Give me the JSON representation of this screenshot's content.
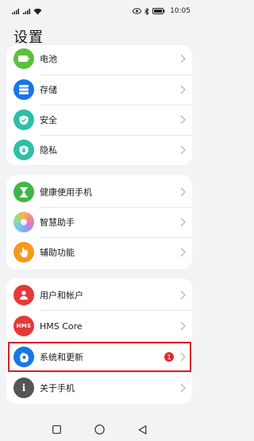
{
  "status_bar": {
    "left_small_1": "5G",
    "left_small_2": "5G",
    "battery": "100",
    "time": "10:05"
  },
  "page_title": "设置",
  "groups": [
    {
      "items": [
        {
          "label": "电池",
          "icon": "battery-icon",
          "color": "#5bbf3d"
        },
        {
          "label": "存储",
          "icon": "storage-icon",
          "color": "#1677e8"
        },
        {
          "label": "安全",
          "icon": "shield-icon",
          "color": "#2ebfa7"
        },
        {
          "label": "隐私",
          "icon": "privacy-icon",
          "color": "#2ebfa7"
        }
      ]
    },
    {
      "items": [
        {
          "label": "健康使用手机",
          "icon": "hourglass-icon",
          "color": "#3fb649"
        },
        {
          "label": "智慧助手",
          "icon": "assistant-icon",
          "color": "#c78af0"
        },
        {
          "label": "辅助功能",
          "icon": "hand-icon",
          "color": "#f59a1b"
        }
      ]
    },
    {
      "items": [
        {
          "label": "用户和帐户",
          "icon": "user-icon",
          "color": "#e4393c"
        },
        {
          "label": "HMS Core",
          "icon": "hms-icon",
          "color": "#e23a3a",
          "icon_text": "HMS"
        },
        {
          "label": "系统和更新",
          "icon": "gear-icon",
          "color": "#1677e8",
          "badge": "1"
        },
        {
          "label": "关于手机",
          "icon": "info-icon",
          "color": "#555555",
          "icon_text": "i"
        }
      ]
    }
  ],
  "colors": {
    "background": "#f1f3f5",
    "highlight": "#d91f26",
    "badge": "#e22b2b"
  }
}
